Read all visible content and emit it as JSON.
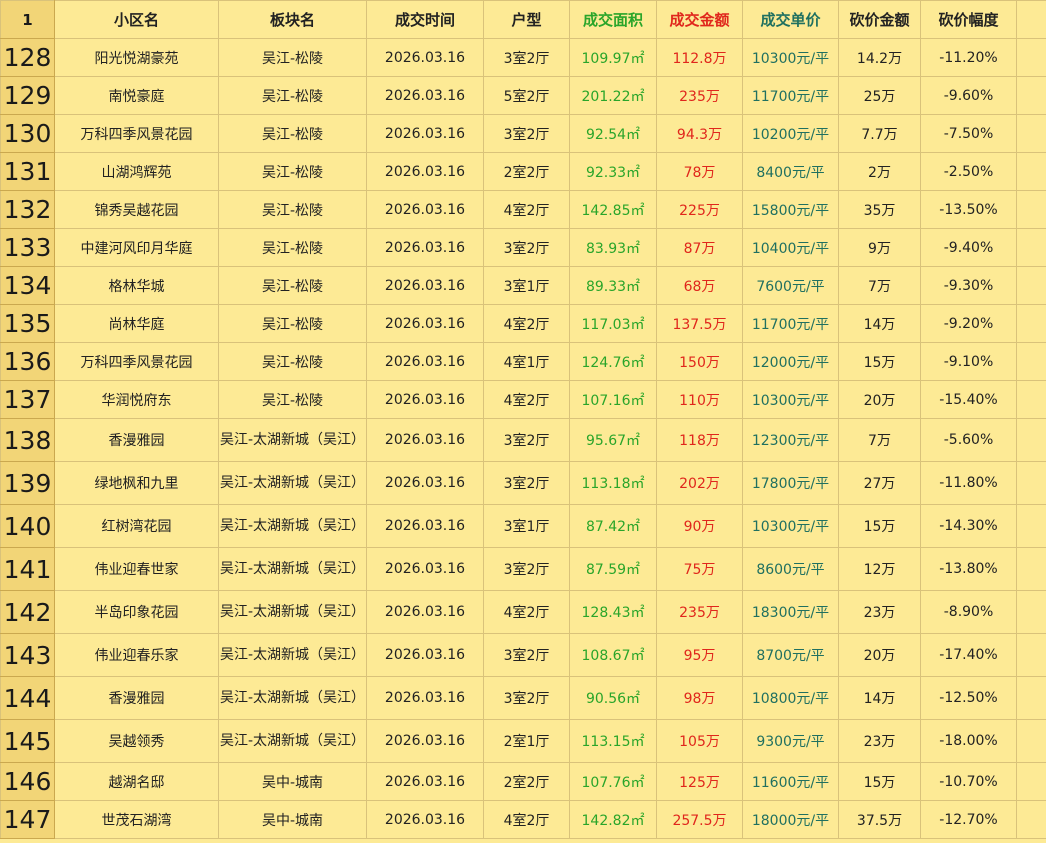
{
  "colors": {
    "area": "#2aa52a",
    "amount": "#e0261c",
    "unit_price": "#207060"
  },
  "header": {
    "row_number": "1",
    "community": "小区名",
    "district": "板块名",
    "date": "成交时间",
    "layout": "户型",
    "area": "成交面积",
    "amount": "成交金额",
    "unit_price": "成交单价",
    "cut_amount": "砍价金额",
    "cut_rate": "砍价幅度"
  },
  "rows": [
    {
      "num": "128",
      "community": "阳光悦湖豪苑",
      "district": "吴江-松陵",
      "date": "2026.03.16",
      "layout": "3室2厅",
      "area": "109.97㎡",
      "amount": "112.8万",
      "unit_price": "10300元/平",
      "cut_amount": "14.2万",
      "cut_rate": "-11.20%"
    },
    {
      "num": "129",
      "community": "南悦豪庭",
      "district": "吴江-松陵",
      "date": "2026.03.16",
      "layout": "5室2厅",
      "area": "201.22㎡",
      "amount": "235万",
      "unit_price": "11700元/平",
      "cut_amount": "25万",
      "cut_rate": "-9.60%"
    },
    {
      "num": "130",
      "community": "万科四季风景花园",
      "district": "吴江-松陵",
      "date": "2026.03.16",
      "layout": "3室2厅",
      "area": "92.54㎡",
      "amount": "94.3万",
      "unit_price": "10200元/平",
      "cut_amount": "7.7万",
      "cut_rate": "-7.50%"
    },
    {
      "num": "131",
      "community": "山湖鸿辉苑",
      "district": "吴江-松陵",
      "date": "2026.03.16",
      "layout": "2室2厅",
      "area": "92.33㎡",
      "amount": "78万",
      "unit_price": "8400元/平",
      "cut_amount": "2万",
      "cut_rate": "-2.50%"
    },
    {
      "num": "132",
      "community": "锦秀吴越花园",
      "district": "吴江-松陵",
      "date": "2026.03.16",
      "layout": "4室2厅",
      "area": "142.85㎡",
      "amount": "225万",
      "unit_price": "15800元/平",
      "cut_amount": "35万",
      "cut_rate": "-13.50%"
    },
    {
      "num": "133",
      "community": "中建河风印月华庭",
      "district": "吴江-松陵",
      "date": "2026.03.16",
      "layout": "3室2厅",
      "area": "83.93㎡",
      "amount": "87万",
      "unit_price": "10400元/平",
      "cut_amount": "9万",
      "cut_rate": "-9.40%"
    },
    {
      "num": "134",
      "community": "格林华城",
      "district": "吴江-松陵",
      "date": "2026.03.16",
      "layout": "3室1厅",
      "area": "89.33㎡",
      "amount": "68万",
      "unit_price": "7600元/平",
      "cut_amount": "7万",
      "cut_rate": "-9.30%"
    },
    {
      "num": "135",
      "community": "尚林华庭",
      "district": "吴江-松陵",
      "date": "2026.03.16",
      "layout": "4室2厅",
      "area": "117.03㎡",
      "amount": "137.5万",
      "unit_price": "11700元/平",
      "cut_amount": "14万",
      "cut_rate": "-9.20%"
    },
    {
      "num": "136",
      "community": "万科四季风景花园",
      "district": "吴江-松陵",
      "date": "2026.03.16",
      "layout": "4室1厅",
      "area": "124.76㎡",
      "amount": "150万",
      "unit_price": "12000元/平",
      "cut_amount": "15万",
      "cut_rate": "-9.10%"
    },
    {
      "num": "137",
      "community": "华润悦府东",
      "district": "吴江-松陵",
      "date": "2026.03.16",
      "layout": "4室2厅",
      "area": "107.16㎡",
      "amount": "110万",
      "unit_price": "10300元/平",
      "cut_amount": "20万",
      "cut_rate": "-15.40%"
    },
    {
      "num": "138",
      "community": "香漫雅园",
      "district": "吴江-太湖新城（吴江）",
      "date": "2026.03.16",
      "layout": "3室2厅",
      "area": "95.67㎡",
      "amount": "118万",
      "unit_price": "12300元/平",
      "cut_amount": "7万",
      "cut_rate": "-5.60%"
    },
    {
      "num": "139",
      "community": "绿地枫和九里",
      "district": "吴江-太湖新城（吴江）",
      "date": "2026.03.16",
      "layout": "3室2厅",
      "area": "113.18㎡",
      "amount": "202万",
      "unit_price": "17800元/平",
      "cut_amount": "27万",
      "cut_rate": "-11.80%"
    },
    {
      "num": "140",
      "community": "红树湾花园",
      "district": "吴江-太湖新城（吴江）",
      "date": "2026.03.16",
      "layout": "3室1厅",
      "area": "87.42㎡",
      "amount": "90万",
      "unit_price": "10300元/平",
      "cut_amount": "15万",
      "cut_rate": "-14.30%"
    },
    {
      "num": "141",
      "community": "伟业迎春世家",
      "district": "吴江-太湖新城（吴江）",
      "date": "2026.03.16",
      "layout": "3室2厅",
      "area": "87.59㎡",
      "amount": "75万",
      "unit_price": "8600元/平",
      "cut_amount": "12万",
      "cut_rate": "-13.80%"
    },
    {
      "num": "142",
      "community": "半岛印象花园",
      "district": "吴江-太湖新城（吴江）",
      "date": "2026.03.16",
      "layout": "4室2厅",
      "area": "128.43㎡",
      "amount": "235万",
      "unit_price": "18300元/平",
      "cut_amount": "23万",
      "cut_rate": "-8.90%"
    },
    {
      "num": "143",
      "community": "伟业迎春乐家",
      "district": "吴江-太湖新城（吴江）",
      "date": "2026.03.16",
      "layout": "3室2厅",
      "area": "108.67㎡",
      "amount": "95万",
      "unit_price": "8700元/平",
      "cut_amount": "20万",
      "cut_rate": "-17.40%"
    },
    {
      "num": "144",
      "community": "香漫雅园",
      "district": "吴江-太湖新城（吴江）",
      "date": "2026.03.16",
      "layout": "3室2厅",
      "area": "90.56㎡",
      "amount": "98万",
      "unit_price": "10800元/平",
      "cut_amount": "14万",
      "cut_rate": "-12.50%"
    },
    {
      "num": "145",
      "community": "吴越领秀",
      "district": "吴江-太湖新城（吴江）",
      "date": "2026.03.16",
      "layout": "2室1厅",
      "area": "113.15㎡",
      "amount": "105万",
      "unit_price": "9300元/平",
      "cut_amount": "23万",
      "cut_rate": "-18.00%"
    },
    {
      "num": "146",
      "community": "越湖名邸",
      "district": "吴中-城南",
      "date": "2026.03.16",
      "layout": "2室2厅",
      "area": "107.76㎡",
      "amount": "125万",
      "unit_price": "11600元/平",
      "cut_amount": "15万",
      "cut_rate": "-10.70%"
    },
    {
      "num": "147",
      "community": "世茂石湖湾",
      "district": "吴中-城南",
      "date": "2026.03.16",
      "layout": "4室2厅",
      "area": "142.82㎡",
      "amount": "257.5万",
      "unit_price": "18000元/平",
      "cut_amount": "37.5万",
      "cut_rate": "-12.70%"
    }
  ]
}
